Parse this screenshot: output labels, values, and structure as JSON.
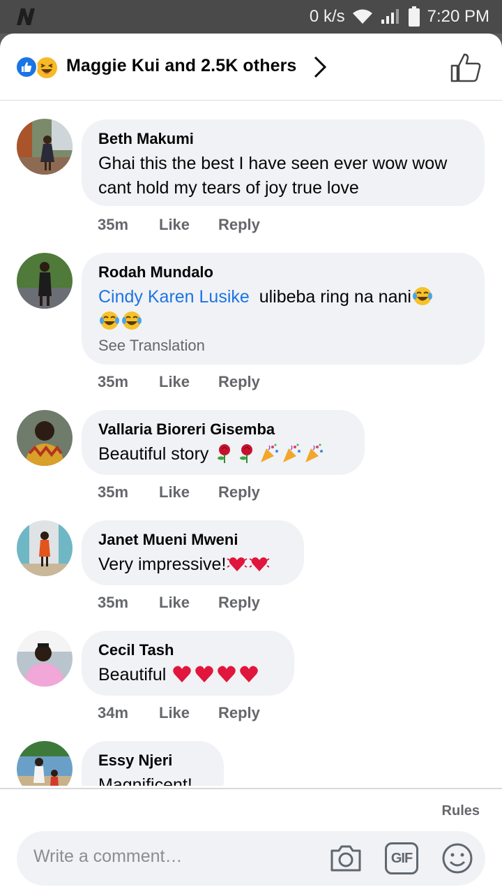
{
  "status_bar": {
    "net_speed": "0 k/s",
    "time": "7:20 PM"
  },
  "reactions": {
    "summary": "Maggie Kui and 2.5K others"
  },
  "comments": [
    {
      "name": "Beth Makumi",
      "text": "Ghai this the best I have seen ever wow wow cant hold my tears of joy true love",
      "time": "35m",
      "like": "Like",
      "reply": "Reply"
    },
    {
      "name": "Rodah Mundalo",
      "mention": "Cindy Karen Lusike",
      "text": "ulibeba ring na nani",
      "translate": "See Translation",
      "time": "35m",
      "like": "Like",
      "reply": "Reply"
    },
    {
      "name": "Vallaria Bioreri Gisemba",
      "text": "Beautiful story",
      "time": "35m",
      "like": "Like",
      "reply": "Reply"
    },
    {
      "name": "Janet Mueni Mweni",
      "text": "Very impressive!",
      "time": "35m",
      "like": "Like",
      "reply": "Reply"
    },
    {
      "name": "Cecil Tash",
      "text": "Beautiful",
      "time": "34m",
      "like": "Like",
      "reply": "Reply"
    },
    {
      "name": "Essy Njeri",
      "text": "Magnificent!"
    }
  ],
  "composer": {
    "rules": "Rules",
    "placeholder": "Write a comment…",
    "gif": "GIF"
  },
  "icons": [
    "wifi-icon",
    "signal-icon",
    "battery-icon",
    "like-reaction-icon",
    "haha-reaction-icon",
    "chevron-right-icon",
    "thumbs-up-icon",
    "camera-icon",
    "gif-icon",
    "emoji-icon"
  ],
  "colors": {
    "accent": "#1b74e4",
    "bubble": "#f0f2f5",
    "secondary_text": "#65676b"
  }
}
